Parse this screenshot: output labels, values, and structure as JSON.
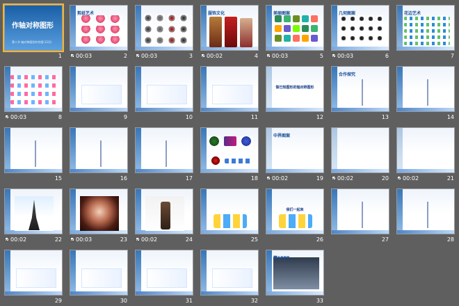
{
  "ui": {
    "background": "#5f5f5f",
    "selected_outline": "#f2b632"
  },
  "slides": [
    {
      "number": "1",
      "time": "",
      "kind": "title",
      "title": "作轴对称图形",
      "subtitle": "第二节 轴对称图形的作图(12月)",
      "selected": true
    },
    {
      "number": "2",
      "time": "00:03",
      "kind": "pattern",
      "title": "剪纸艺术",
      "pattern": "butterflies"
    },
    {
      "number": "3",
      "time": "00:03",
      "kind": "pattern",
      "title": "",
      "pattern": "medallions"
    },
    {
      "number": "4",
      "time": "00:02",
      "kind": "pattern",
      "title": "服饰文化",
      "pattern": "clothes"
    },
    {
      "number": "5",
      "time": "00:03",
      "kind": "pattern",
      "title": "美丽图案",
      "pattern": "tiles"
    },
    {
      "number": "6",
      "time": "00:03",
      "kind": "pattern",
      "title": "几何图案",
      "pattern": "geometric"
    },
    {
      "number": "7",
      "time": "",
      "kind": "pattern",
      "title": "花边艺术",
      "pattern": "borders"
    },
    {
      "number": "8",
      "time": "00:03",
      "kind": "pattern",
      "title": "",
      "pattern": "borders2"
    },
    {
      "number": "9",
      "time": "",
      "kind": "content",
      "title": "",
      "lines": [
        "",
        "",
        ""
      ]
    },
    {
      "number": "10",
      "time": "",
      "kind": "content",
      "title": "",
      "lines": [
        "",
        "",
        ""
      ]
    },
    {
      "number": "11",
      "time": "",
      "kind": "content",
      "title": "",
      "lines": [
        "",
        "",
        ""
      ]
    },
    {
      "number": "12",
      "time": "",
      "kind": "text",
      "title": "",
      "center": "做已知图形的轴对称图形"
    },
    {
      "number": "13",
      "time": "",
      "kind": "diagram",
      "title": "合作探究"
    },
    {
      "number": "14",
      "time": "",
      "kind": "diagram",
      "title": ""
    },
    {
      "number": "15",
      "time": "",
      "kind": "diagram",
      "title": ""
    },
    {
      "number": "16",
      "time": "",
      "kind": "diagram",
      "title": ""
    },
    {
      "number": "17",
      "time": "",
      "kind": "diagram",
      "title": ""
    },
    {
      "number": "18",
      "time": "",
      "kind": "pattern",
      "title": "",
      "pattern": "mixed"
    },
    {
      "number": "19",
      "time": "00:02",
      "kind": "text",
      "title": "中界图案",
      "center": ""
    },
    {
      "number": "20",
      "time": "00:02",
      "kind": "empty",
      "title": ""
    },
    {
      "number": "21",
      "time": "00:02",
      "kind": "empty",
      "title": ""
    },
    {
      "number": "22",
      "time": "00:02",
      "kind": "photo",
      "title": "",
      "photo": "tower"
    },
    {
      "number": "23",
      "time": "00:03",
      "kind": "photo",
      "title": "",
      "photo": "sphere"
    },
    {
      "number": "24",
      "time": "00:02",
      "kind": "photo",
      "title": "",
      "photo": "idol"
    },
    {
      "number": "25",
      "time": "",
      "kind": "cartoon",
      "title": ""
    },
    {
      "number": "26",
      "time": "",
      "kind": "cartoon",
      "title": "",
      "center": "我们一起来"
    },
    {
      "number": "27",
      "time": "",
      "kind": "diagram",
      "title": ""
    },
    {
      "number": "28",
      "time": "",
      "kind": "diagram",
      "title": ""
    },
    {
      "number": "29",
      "time": "",
      "kind": "content",
      "title": "",
      "lines": [
        "",
        "",
        ""
      ]
    },
    {
      "number": "30",
      "time": "",
      "kind": "content",
      "title": "",
      "lines": [
        "",
        "",
        ""
      ]
    },
    {
      "number": "31",
      "time": "",
      "kind": "content",
      "title": "",
      "lines": [
        "",
        "",
        ""
      ]
    },
    {
      "number": "32",
      "time": "",
      "kind": "content",
      "title": "",
      "lines": [
        "",
        "",
        ""
      ]
    },
    {
      "number": "33",
      "time": "",
      "kind": "ad",
      "title": "第1PPT"
    }
  ]
}
